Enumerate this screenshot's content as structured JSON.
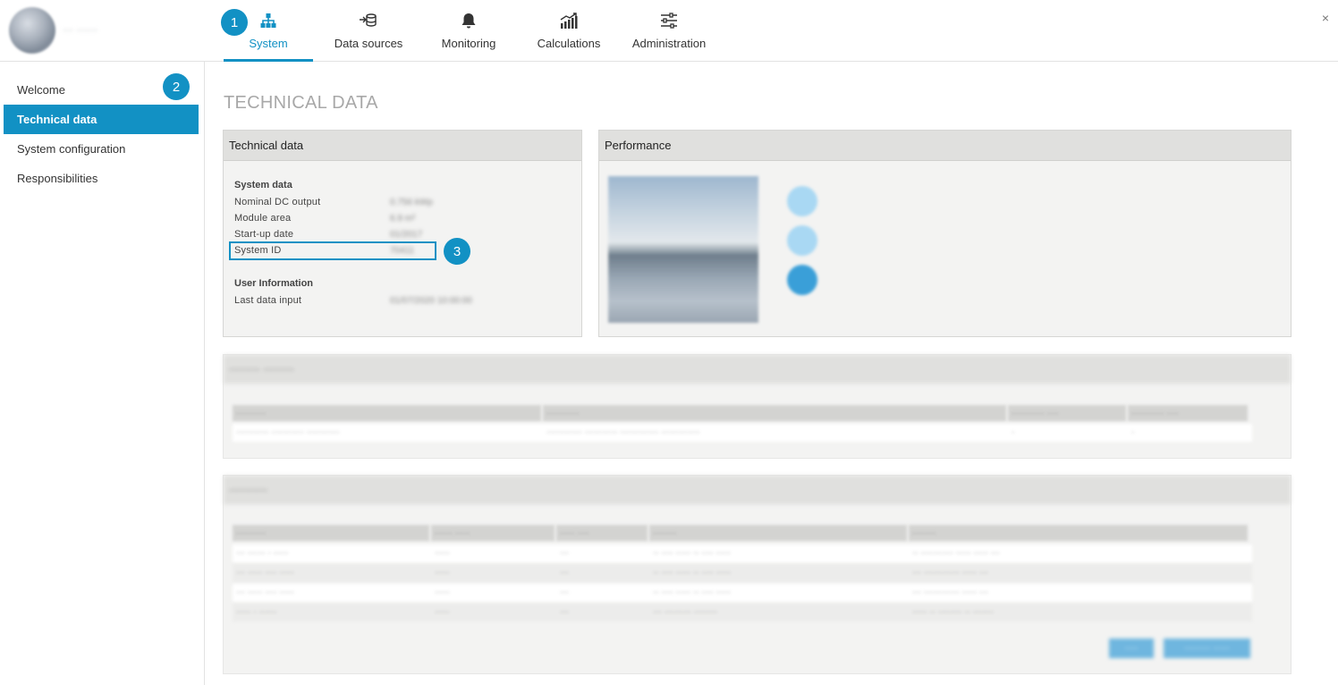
{
  "brand": {
    "name": "··· ······"
  },
  "nav": {
    "items": [
      {
        "label": "System",
        "icon": "sitemap-icon",
        "active": true
      },
      {
        "label": "Data sources",
        "icon": "database-import-icon",
        "active": false
      },
      {
        "label": "Monitoring",
        "icon": "bell-icon",
        "active": false
      },
      {
        "label": "Calculations",
        "icon": "chart-growth-icon",
        "active": false
      },
      {
        "label": "Administration",
        "icon": "sliders-icon",
        "active": false
      }
    ],
    "close": "×"
  },
  "badges": [
    "1",
    "2",
    "3"
  ],
  "sidebar": {
    "items": [
      {
        "label": "Welcome",
        "active": false
      },
      {
        "label": "Technical data",
        "active": true
      },
      {
        "label": "System configuration",
        "active": false
      },
      {
        "label": "Responsibilities",
        "active": false
      }
    ]
  },
  "main": {
    "title": "TECHNICAL DATA",
    "technical": {
      "header": "Technical data",
      "system_data_title": "System data",
      "rows": [
        {
          "label": "Nominal DC output",
          "value": "0.756 kWp"
        },
        {
          "label": "Module area",
          "value": "6.9 m²"
        },
        {
          "label": "Start-up date",
          "value": "01/2017"
        },
        {
          "label": "System ID",
          "value": "70411"
        }
      ],
      "user_info_title": "User Information",
      "user_rows": [
        {
          "label": "Last data input",
          "value": "01/07/2020 10:00:00"
        }
      ]
    },
    "performance": {
      "header": "Performance"
    },
    "blurred1": {
      "header": "········ ········",
      "columns": [
        "··········",
        "···········",
        "··········· ····",
        "··········· ····"
      ],
      "row": [
        "··········· ··········· ···········",
        "············ ··········· ············· ·············",
        "·",
        "·"
      ]
    },
    "blurred2": {
      "header": "··········",
      "columns": [
        "··········",
        "······ ·····",
        "····· ····",
        "········",
        "········"
      ],
      "rows": [
        [
          "··· ······ · ·····",
          "·····",
          "···",
          "·· ···· ····· ·· ···· ·····",
          "·· ··········· ····· ····· ···"
        ],
        [
          "··· ····· ···· ·····",
          "·····",
          "···",
          "·· ···· ····· ·· ···· ·····",
          "··· ············ ····· ···"
        ],
        [
          "··· ····· ···· ·····",
          "·····",
          "···",
          "·· ···· ····· ·· ···· ·····",
          "··· ············ ····· ···"
        ],
        [
          "····· · ······",
          "·····",
          "···",
          "··· ········· ········",
          "····· ·· ········ ·· ·······"
        ]
      ],
      "buttons": [
        "····",
        "········ ·····"
      ]
    }
  }
}
